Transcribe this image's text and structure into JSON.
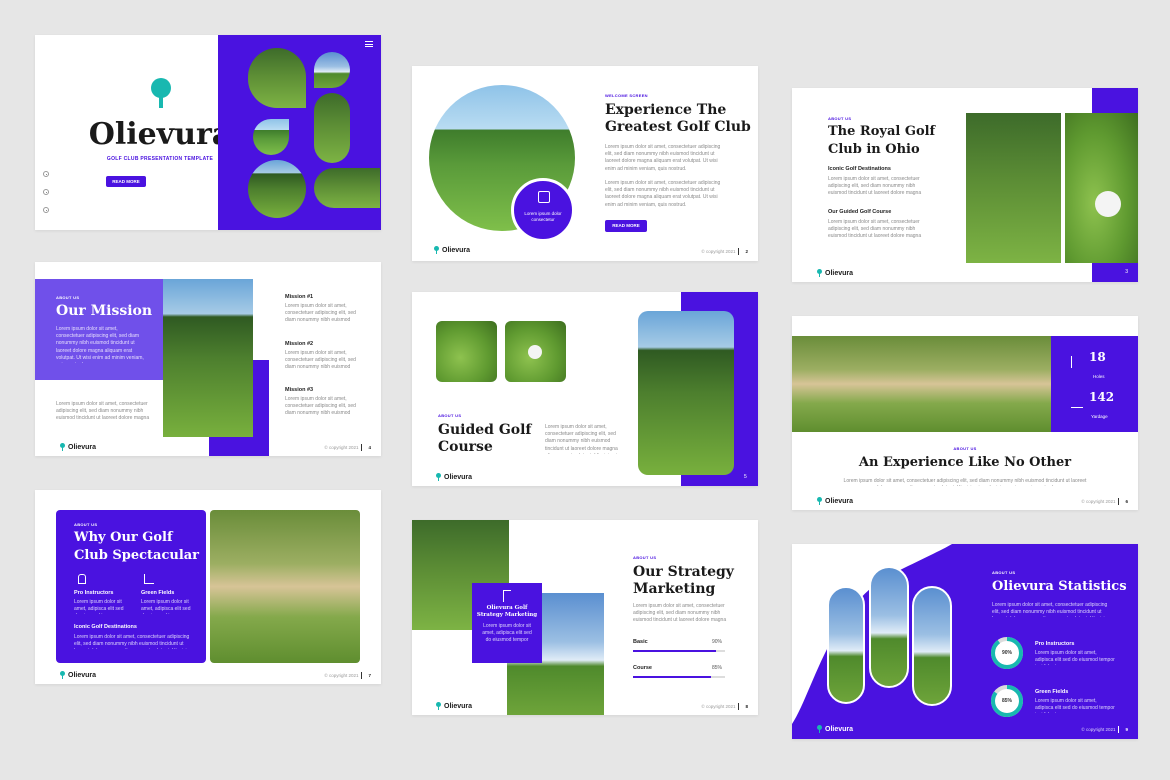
{
  "brand": "Olievura",
  "copyright": "© copyright 2021",
  "lorem_long": "Lorem ipsum dolor sit amet, consectetuer adipiscing elit, sed diam nonummy nibh euismod tincidunt ut laoreet dolore magna aliquam erat volutpat. Ut wisi enim ad minim veniam, quis nostrud.",
  "lorem_short": "Lorem ipsum dolor sit amet, adipisca elit sed do eiusmod tempor incididunt.",
  "slide1": {
    "title": "Olievura",
    "subtitle": "GOLF CLUB PRESENTATION TEMPLATE",
    "button": "READ MORE",
    "menu_icon": "hamburger-icon"
  },
  "slide2": {
    "kicker": "WELCOME SCREEN",
    "title_line1": "Experience The",
    "title_line2": "Greatest Golf Club",
    "badge_text": "Lorem ipsum dolor consectetur",
    "button": "READ MORE",
    "page": "2"
  },
  "slide3": {
    "kicker": "ABOUT US",
    "title_line1": "The Royal Golf",
    "title_line2": "Club in Ohio",
    "sub1": "Iconic Golf Destinations",
    "sub2": "Our Guided Golf Course",
    "page": "3"
  },
  "slide4": {
    "kicker": "ABOUT US",
    "title": "Our Mission",
    "mission1": "Mission #1",
    "mission2": "Mission #2",
    "mission3": "Mission #3",
    "page": "4"
  },
  "slide5": {
    "kicker": "ABOUT US",
    "title_line1": "Guided Golf",
    "title_line2": "Course",
    "page": "5"
  },
  "slide6": {
    "kicker": "ABOUT US",
    "title": "An Experience Like No Other",
    "stat1_value": "18",
    "stat1_label": "Holes",
    "stat2_value": "142",
    "stat2_label": "Yardage",
    "page": "6"
  },
  "slide7": {
    "kicker": "ABOUT US",
    "title_line1": "Why Our Golf",
    "title_line2": "Club Spectacular",
    "feat1": "Pro Instructors",
    "feat2": "Green Fields",
    "sub": "Iconic Golf Destinations",
    "page": "7"
  },
  "slide8": {
    "kicker": "ABOUT US",
    "title_line1": "Our Strategy",
    "title_line2": "Marketing",
    "card_title_line1": "Olievura Golf",
    "card_title_line2": "Strategy Marketing",
    "bar1_label": "Basic",
    "bar1_value": "90%",
    "bar1_fill": 0.9,
    "bar2_label": "Course",
    "bar2_value": "85%",
    "bar2_fill": 0.85,
    "page": "8"
  },
  "slide9": {
    "kicker": "ABOUT US",
    "title": "Olievura Statistics",
    "stat1_value": "90%",
    "stat1_fill": 0.9,
    "stat1_label": "Pro Instructors",
    "stat2_value": "85%",
    "stat2_fill": 0.85,
    "stat2_label": "Green Fields",
    "page": "9"
  },
  "colors": {
    "accent": "#4a12e0",
    "teal": "#18b8b0"
  }
}
